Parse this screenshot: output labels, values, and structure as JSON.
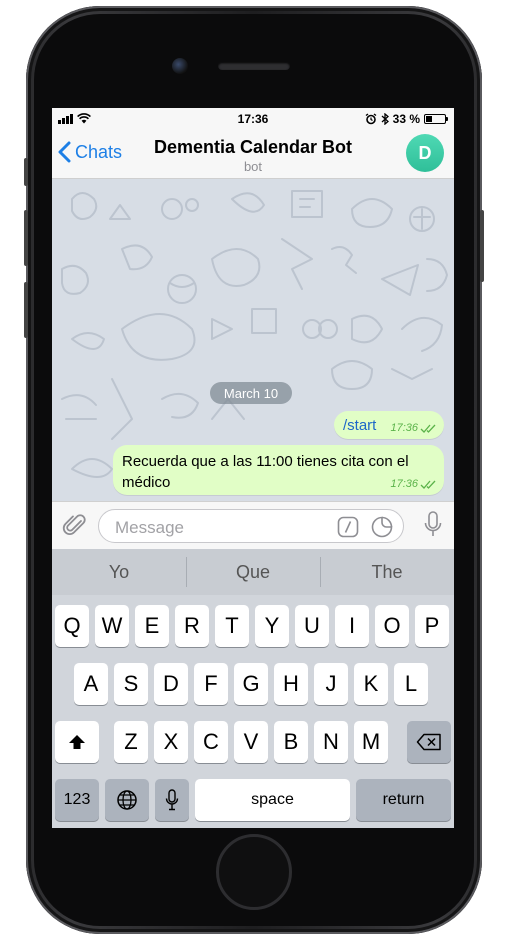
{
  "status_bar": {
    "time": "17:36",
    "battery": "33 %",
    "battery_level": 0.33
  },
  "header": {
    "back_label": "Chats",
    "title": "Dementia Calendar Bot",
    "subtitle": "bot",
    "avatar_letter": "D"
  },
  "chat": {
    "date": "March 10",
    "messages": [
      {
        "text": "/start",
        "time": "17:36"
      },
      {
        "text": "Recuerda que a las 11:00 tienes cita con el médico",
        "time": "17:36"
      }
    ]
  },
  "composer": {
    "placeholder": "Message"
  },
  "keyboard": {
    "suggestions": [
      "Yo",
      "Que",
      "The"
    ],
    "row1": [
      "Q",
      "W",
      "E",
      "R",
      "T",
      "Y",
      "U",
      "I",
      "O",
      "P"
    ],
    "row2": [
      "A",
      "S",
      "D",
      "F",
      "G",
      "H",
      "J",
      "K",
      "L"
    ],
    "row3": [
      "Z",
      "X",
      "C",
      "V",
      "B",
      "N",
      "M"
    ],
    "numbers_label": "123",
    "space_label": "space",
    "return_label": "return"
  },
  "colors": {
    "accent": "#1d7fe6",
    "bubble": "#e1fec6",
    "chat_bg": "#d7dde5",
    "avatar": "#3cc9a4"
  }
}
